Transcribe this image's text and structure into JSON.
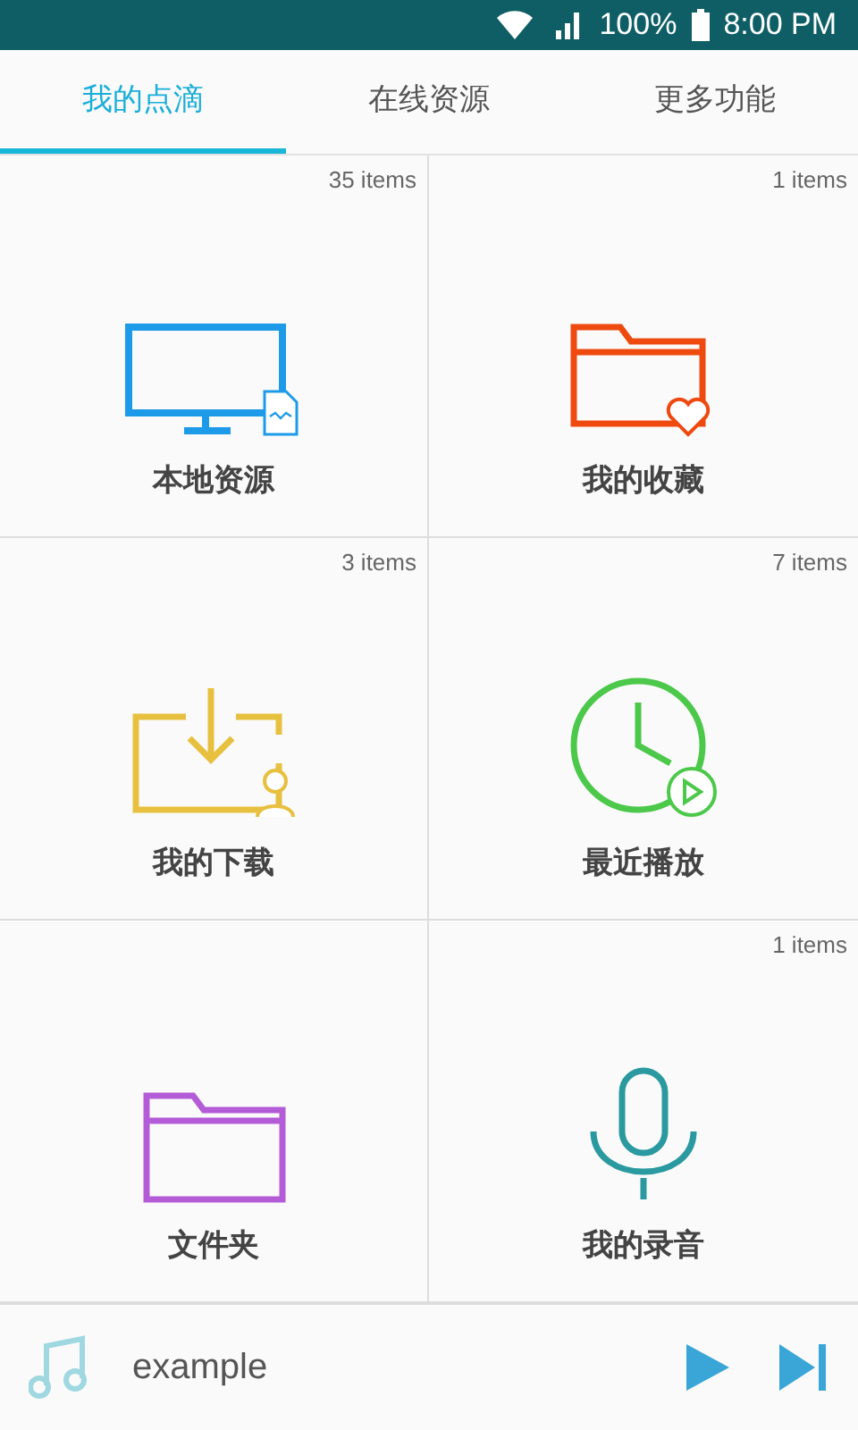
{
  "status_bar": {
    "battery": "100%",
    "time": "8:00 PM"
  },
  "tabs": [
    {
      "label": "我的点滴",
      "selected": true
    },
    {
      "label": "在线资源",
      "selected": false
    },
    {
      "label": "更多功能",
      "selected": false
    }
  ],
  "tiles": [
    {
      "kind": "monitor",
      "label": "本地资源",
      "count": "35 items"
    },
    {
      "kind": "favorites",
      "label": "我的收藏",
      "count": "1 items"
    },
    {
      "kind": "download",
      "label": "我的下载",
      "count": "3 items"
    },
    {
      "kind": "recent",
      "label": "最近播放",
      "count": "7 items"
    },
    {
      "kind": "folder",
      "label": "文件夹"
    },
    {
      "kind": "mic",
      "label": "我的录音",
      "count": "1 items"
    }
  ],
  "player": {
    "title": "example"
  }
}
